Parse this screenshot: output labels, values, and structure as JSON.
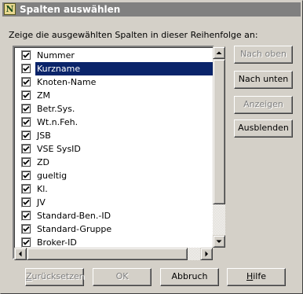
{
  "window": {
    "title": "Spalten auswählen",
    "icon_letter": "N"
  },
  "instruction": "Zeige die ausgewählten Spalten in dieser Reihenfolge an:",
  "columns": [
    {
      "label": "Nummer",
      "checked": true,
      "selected": false
    },
    {
      "label": "Kurzname",
      "checked": true,
      "selected": true
    },
    {
      "label": "Knoten-Name",
      "checked": true,
      "selected": false
    },
    {
      "label": "ZM",
      "checked": true,
      "selected": false
    },
    {
      "label": "Betr.Sys.",
      "checked": true,
      "selected": false
    },
    {
      "label": "Wt.n.Feh.",
      "checked": true,
      "selected": false
    },
    {
      "label": "JSB",
      "checked": true,
      "selected": false
    },
    {
      "label": "VSE SysID",
      "checked": true,
      "selected": false
    },
    {
      "label": "ZD",
      "checked": true,
      "selected": false
    },
    {
      "label": "gueltig",
      "checked": true,
      "selected": false
    },
    {
      "label": "Kl.",
      "checked": true,
      "selected": false
    },
    {
      "label": "JV",
      "checked": true,
      "selected": false
    },
    {
      "label": "Standard-Ben.-ID",
      "checked": true,
      "selected": false
    },
    {
      "label": "Standard-Gruppe",
      "checked": true,
      "selected": false
    },
    {
      "label": "Broker-ID",
      "checked": true,
      "selected": false
    }
  ],
  "side_buttons": {
    "move_up": {
      "label": "Nach oben",
      "enabled": false
    },
    "move_down": {
      "label": "Nach unten",
      "enabled": true
    },
    "show": {
      "label": "Anzeigen",
      "enabled": false
    },
    "hide": {
      "label": "Ausblenden",
      "enabled": true
    }
  },
  "bottom_buttons": {
    "reset": {
      "pre": "",
      "acc": "Z",
      "post": "urücksetzen",
      "enabled": false
    },
    "ok": {
      "label": "OK",
      "enabled": false
    },
    "cancel": {
      "label": "Abbruch",
      "enabled": true
    },
    "help": {
      "pre": "",
      "acc": "H",
      "post": "ilfe",
      "enabled": true
    }
  },
  "colors": {
    "face": "#d4d0c8",
    "selection": "#0a246a",
    "titlebar_inactive": "#808080"
  },
  "icons": {
    "app": "norton-n-icon",
    "check": "checkmark-icon",
    "scroll_up": "arrow-up-icon",
    "scroll_down": "arrow-down-icon",
    "scroll_left": "arrow-left-icon",
    "scroll_right": "arrow-right-icon",
    "grip": "size-grip-icon"
  }
}
